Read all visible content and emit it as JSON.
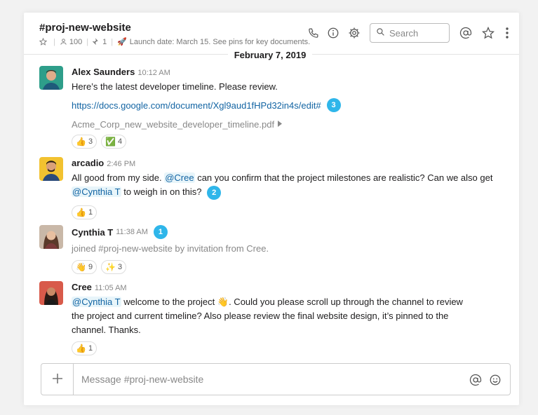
{
  "channel": {
    "name": "#proj-new-website",
    "members": "100",
    "pins": "1",
    "topic_emoji": "🚀",
    "topic": "Launch date: March 15. See pins for key documents."
  },
  "header": {
    "search_placeholder": "Search",
    "icons": [
      "star-icon",
      "person-icon",
      "pin-icon",
      "phone-icon",
      "info-icon",
      "gear-icon",
      "search-icon",
      "at-icon",
      "star-icon",
      "more-icon"
    ]
  },
  "date_divider": "February 7, 2019",
  "messages": [
    {
      "author": "Alex Saunders",
      "time": "10:12 AM",
      "text": "Here’s the latest developer timeline. Please review.",
      "link": "https://docs.google.com/document/Xgl9aud1fHPd32in4s/edit#",
      "link_badge": "3",
      "file": "Acme_Corp_new_website_developer_timeline.pdf",
      "reactions": [
        {
          "emoji": "👍",
          "count": "3"
        },
        {
          "emoji": "✅",
          "count": "4"
        }
      ]
    },
    {
      "author": "arcadio",
      "time": "2:46 PM",
      "text_a": "All good from my side. ",
      "mention_a": "@Cree",
      "text_b": " can you confirm that the project milestones are realistic? Can we also get",
      "mention_b": "@Cynthia T",
      "text_c": " to weigh in on this?",
      "badge": "2",
      "reactions": [
        {
          "emoji": "👍",
          "count": "1"
        }
      ]
    },
    {
      "author": "Cynthia T",
      "time": "11:38 AM",
      "badge": "1",
      "text": "joined #proj-new-website by invitation from Cree.",
      "reactions": [
        {
          "emoji": "👋",
          "count": "9"
        },
        {
          "emoji": "✨",
          "count": "3"
        }
      ]
    },
    {
      "author": "Cree",
      "time": "11:05 AM",
      "mention": "@Cynthia T",
      "text_a": " welcome to the project ",
      "wave": "👋",
      "text_b": ". Could you please scroll up through the channel to review",
      "line2": "the project and current timeline? Also please review the final website design, it’s pinned to the",
      "line3": "channel. Thanks.",
      "reactions": [
        {
          "emoji": "👍",
          "count": "1"
        }
      ]
    }
  ],
  "composer": {
    "placeholder": "Message #proj-new-website"
  },
  "colors": {
    "link": "#1264a3",
    "badge": "#2fb6ea",
    "mention_bg": "#e8f5fa"
  }
}
